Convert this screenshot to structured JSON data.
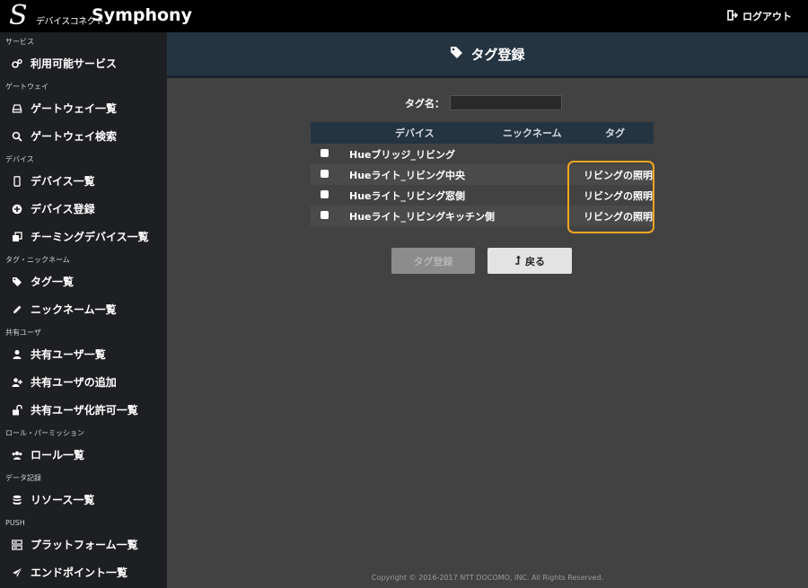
{
  "app": {
    "logo_letter": "S",
    "logo_sub": "デバイスコネクト",
    "logo_main": "Symphony",
    "logout_label": "ログアウト"
  },
  "sidebar": {
    "sections": [
      {
        "title": "サービス",
        "items": [
          {
            "label": "利用可能サービス",
            "icon": "cogs-icon"
          }
        ]
      },
      {
        "title": "ゲートウェイ",
        "items": [
          {
            "label": "ゲートウェイ一覧",
            "icon": "hdd-icon"
          },
          {
            "label": "ゲートウェイ検索",
            "icon": "search-icon"
          }
        ]
      },
      {
        "title": "デバイス",
        "items": [
          {
            "label": "デバイス一覧",
            "icon": "mobile-icon"
          },
          {
            "label": "デバイス登録",
            "icon": "plus-circle-icon"
          },
          {
            "label": "チーミングデバイス一覧",
            "icon": "clone-icon"
          }
        ]
      },
      {
        "title": "タグ・ニックネーム",
        "items": [
          {
            "label": "タグ一覧",
            "icon": "tags-icon"
          },
          {
            "label": "ニックネーム一覧",
            "icon": "pencil-icon"
          }
        ]
      },
      {
        "title": "共有ユーザ",
        "items": [
          {
            "label": "共有ユーザ一覧",
            "icon": "user-icon"
          },
          {
            "label": "共有ユーザの追加",
            "icon": "user-plus-icon"
          },
          {
            "label": "共有ユーザ化許可一覧",
            "icon": "unlock-icon"
          }
        ]
      },
      {
        "title": "ロール・パーミッション",
        "items": [
          {
            "label": "ロール一覧",
            "icon": "users-icon"
          }
        ]
      },
      {
        "title": "データ記録",
        "items": [
          {
            "label": "リソース一覧",
            "icon": "database-icon"
          }
        ]
      },
      {
        "title": "PUSH",
        "items": [
          {
            "label": "プラットフォーム一覧",
            "icon": "server-icon"
          },
          {
            "label": "エンドポイント一覧",
            "icon": "send-icon"
          }
        ]
      }
    ]
  },
  "page": {
    "title": "タグ登録",
    "title_icon": "tag-icon",
    "tag_name_label": "タグ名：",
    "tag_name_value": ""
  },
  "table": {
    "headers": [
      "",
      "デバイス",
      "ニックネーム",
      "タグ"
    ],
    "rows": [
      {
        "device": "Hueブリッジ_リビング",
        "nickname": "",
        "tag": ""
      },
      {
        "device": "Hueライト_リビング中央",
        "nickname": "",
        "tag": "リビングの照明"
      },
      {
        "device": "Hueライト_リビング窓側",
        "nickname": "",
        "tag": "リビングの照明"
      },
      {
        "device": "Hueライト_リビングキッチン側",
        "nickname": "",
        "tag": "リビングの照明"
      }
    ]
  },
  "buttons": {
    "register_label": "タグ登録",
    "back_label": "戻る",
    "back_icon": "level-up-icon"
  },
  "footer": {
    "copyright": "Copyright © 2016-2017 NTT DOCOMO, INC. All Rights Reserved."
  },
  "colors": {
    "highlight": "#f2a51f",
    "header_bg": "#253441",
    "sidebar_bg": "#1e1f22"
  }
}
